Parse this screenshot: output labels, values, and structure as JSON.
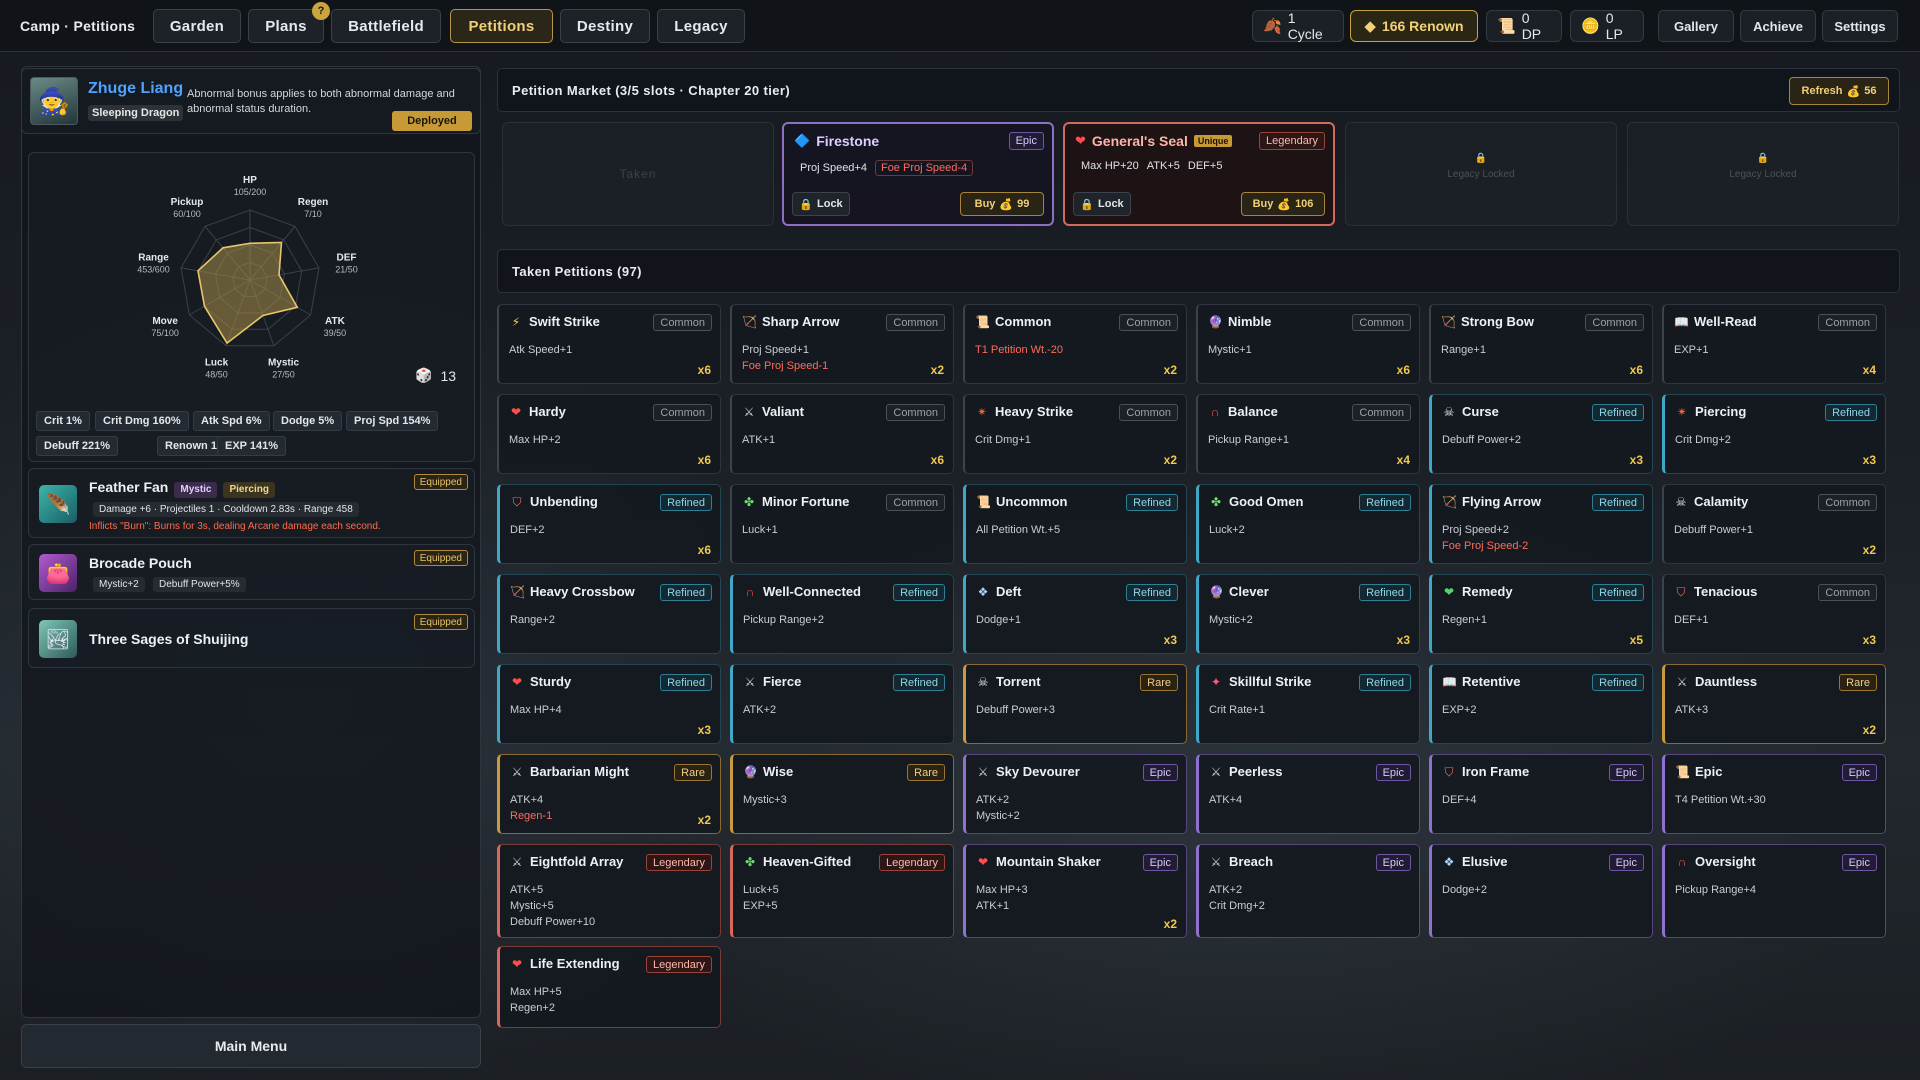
{
  "topbar": {
    "breadcrumb": "Camp · Petitions",
    "tabs": [
      "Garden",
      "Plans",
      "Battlefield",
      "Petitions",
      "Destiny",
      "Legacy"
    ],
    "active_tab": "Petitions",
    "plans_badge": "?",
    "resources": {
      "cycle": "1 Cycle",
      "renown": "166 Renown",
      "dp": "0 DP",
      "lp": "0 LP"
    },
    "buttons": [
      "Gallery",
      "Achieve",
      "Settings"
    ]
  },
  "hero": {
    "name": "Zhuge Liang",
    "title": "Sleeping Dragon",
    "description": "Abnormal bonus applies to both abnormal damage and abnormal status duration.",
    "status": "Deployed"
  },
  "radar": {
    "axes": [
      {
        "label": "HP",
        "value": "105/200"
      },
      {
        "label": "Regen",
        "value": "7/10"
      },
      {
        "label": "DEF",
        "value": "21/50"
      },
      {
        "label": "ATK",
        "value": "39/50"
      },
      {
        "label": "Mystic",
        "value": "27/50"
      },
      {
        "label": "Luck",
        "value": "48/50"
      },
      {
        "label": "Move",
        "value": "75/100"
      },
      {
        "label": "Range",
        "value": "453/600"
      },
      {
        "label": "Pickup",
        "value": "60/100"
      }
    ],
    "fractions": [
      0.525,
      0.7,
      0.42,
      0.78,
      0.54,
      0.96,
      0.75,
      0.755,
      0.6
    ],
    "dice_value": "13"
  },
  "stat_chips": [
    "Crit 1%",
    "Crit Dmg 160%",
    "Atk Spd 6%",
    "Dodge 5%",
    "Proj Spd 154%",
    "Debuff 221%",
    "Renown 120%",
    "EXP 141%"
  ],
  "items": [
    {
      "name": "Feather Fan",
      "tags": [
        "Mystic",
        "Piercing"
      ],
      "status": "Equipped",
      "stats": "Damage +6 · Projectiles 1 · Cooldown 2.83s · Range 458",
      "effect": "Inflicts \"Burn\": Burns for 3s, dealing Arcane damage each second."
    },
    {
      "name": "Brocade Pouch",
      "status": "Equipped",
      "stats": [
        "Mystic+2",
        "Debuff Power+5%"
      ]
    },
    {
      "name": "Three Sages of Shuijing",
      "status": "Equipped"
    }
  ],
  "main_menu": "Main Menu",
  "market": {
    "title": "Petition Market (3/5 slots · Chapter 20 tier)",
    "refresh_label": "Refresh",
    "refresh_cost": "56",
    "taken_label": "Taken",
    "locked_label": "Legacy Locked",
    "offers": [
      {
        "name": "Firestone",
        "rarity": "Epic",
        "stats": [
          "Proj Speed+4"
        ],
        "neg_stats": [
          "Foe Proj Speed-4"
        ],
        "lock_label": "Lock",
        "buy_label": "Buy",
        "cost": "99"
      },
      {
        "name": "General's Seal",
        "unique": "Unique",
        "rarity": "Legendary",
        "stats": [
          "Max HP+20",
          "ATK+5",
          "DEF+5"
        ],
        "lock_label": "Lock",
        "buy_label": "Buy",
        "cost": "106"
      }
    ]
  },
  "taken": {
    "title": "Taken Petitions (97)",
    "cards": [
      {
        "name": "Swift Strike",
        "rarity": "Common",
        "icon": "lightning-icon",
        "lines": [
          "Atk Speed+1"
        ],
        "neg": [],
        "count": "x6"
      },
      {
        "name": "Sharp Arrow",
        "rarity": "Common",
        "icon": "arrow-icon",
        "lines": [
          "Proj Speed+1"
        ],
        "neg": [
          "Foe Proj Speed-1"
        ],
        "count": "x2"
      },
      {
        "name": "Common",
        "rarity": "Common",
        "icon": "scroll-icon",
        "lines": [],
        "neg": [
          "T1 Petition Wt.-20"
        ],
        "count": "x2"
      },
      {
        "name": "Nimble",
        "rarity": "Common",
        "icon": "mystic-orb-icon",
        "lines": [
          "Mystic+1"
        ],
        "neg": [],
        "count": "x6"
      },
      {
        "name": "Strong Bow",
        "rarity": "Common",
        "icon": "bow-icon",
        "lines": [
          "Range+1"
        ],
        "neg": [],
        "count": "x6"
      },
      {
        "name": "Well-Read",
        "rarity": "Common",
        "icon": "book-icon",
        "lines": [
          "EXP+1"
        ],
        "neg": [],
        "count": "x4"
      },
      {
        "name": "Hardy",
        "rarity": "Common",
        "icon": "heart-icon",
        "lines": [
          "Max HP+2"
        ],
        "neg": [],
        "count": "x6"
      },
      {
        "name": "Valiant",
        "rarity": "Common",
        "icon": "swords-icon",
        "lines": [
          "ATK+1"
        ],
        "neg": [],
        "count": "x6"
      },
      {
        "name": "Heavy Strike",
        "rarity": "Common",
        "icon": "burst-icon",
        "lines": [
          "Crit Dmg+1"
        ],
        "neg": [],
        "count": "x2"
      },
      {
        "name": "Balance",
        "rarity": "Common",
        "icon": "magnet-icon",
        "lines": [
          "Pickup Range+1"
        ],
        "neg": [],
        "count": "x4"
      },
      {
        "name": "Curse",
        "rarity": "Refined",
        "icon": "skull-icon",
        "lines": [
          "Debuff Power+2"
        ],
        "neg": [],
        "count": "x3"
      },
      {
        "name": "Piercing",
        "rarity": "Refined",
        "icon": "burst-icon",
        "lines": [
          "Crit Dmg+2"
        ],
        "neg": [],
        "count": "x3"
      },
      {
        "name": "Unbending",
        "rarity": "Refined",
        "icon": "shield-icon",
        "lines": [
          "DEF+2"
        ],
        "neg": [],
        "count": "x6"
      },
      {
        "name": "Minor Fortune",
        "rarity": "Common",
        "icon": "clover-icon",
        "lines": [
          "Luck+1"
        ],
        "neg": [],
        "count": ""
      },
      {
        "name": "Uncommon",
        "rarity": "Refined",
        "icon": "scroll-icon",
        "lines": [
          "All Petition Wt.+5"
        ],
        "neg": [],
        "count": ""
      },
      {
        "name": "Good Omen",
        "rarity": "Refined",
        "icon": "clover-icon",
        "lines": [
          "Luck+2"
        ],
        "neg": [],
        "count": ""
      },
      {
        "name": "Flying Arrow",
        "rarity": "Refined",
        "icon": "arrow-icon",
        "lines": [
          "Proj Speed+2"
        ],
        "neg": [
          "Foe Proj Speed-2"
        ],
        "count": ""
      },
      {
        "name": "Calamity",
        "rarity": "Common",
        "icon": "skull-icon",
        "lines": [
          "Debuff Power+1"
        ],
        "neg": [],
        "count": "x2"
      },
      {
        "name": "Heavy Crossbow",
        "rarity": "Refined",
        "icon": "bow-icon",
        "lines": [
          "Range+2"
        ],
        "neg": [],
        "count": ""
      },
      {
        "name": "Well-Connected",
        "rarity": "Refined",
        "icon": "magnet-icon",
        "lines": [
          "Pickup Range+2"
        ],
        "neg": [],
        "count": ""
      },
      {
        "name": "Deft",
        "rarity": "Refined",
        "icon": "wing-icon",
        "lines": [
          "Dodge+1"
        ],
        "neg": [],
        "count": "x3"
      },
      {
        "name": "Clever",
        "rarity": "Refined",
        "icon": "mystic-orb-icon",
        "lines": [
          "Mystic+2"
        ],
        "neg": [],
        "count": "x3"
      },
      {
        "name": "Remedy",
        "rarity": "Refined",
        "icon": "green-heart-icon",
        "lines": [
          "Regen+1"
        ],
        "neg": [],
        "count": "x5"
      },
      {
        "name": "Tenacious",
        "rarity": "Common",
        "icon": "shield-icon",
        "lines": [
          "DEF+1"
        ],
        "neg": [],
        "count": "x3"
      },
      {
        "name": "Sturdy",
        "rarity": "Refined",
        "icon": "heart-icon",
        "lines": [
          "Max HP+4"
        ],
        "neg": [],
        "count": "x3"
      },
      {
        "name": "Fierce",
        "rarity": "Refined",
        "icon": "swords-icon",
        "lines": [
          "ATK+2"
        ],
        "neg": [],
        "count": ""
      },
      {
        "name": "Torrent",
        "rarity": "Rare",
        "icon": "skull-icon",
        "lines": [
          "Debuff Power+3"
        ],
        "neg": [],
        "count": ""
      },
      {
        "name": "Skillful Strike",
        "rarity": "Refined",
        "icon": "crit-icon",
        "lines": [
          "Crit Rate+1"
        ],
        "neg": [],
        "count": ""
      },
      {
        "name": "Retentive",
        "rarity": "Refined",
        "icon": "book-icon",
        "lines": [
          "EXP+2"
        ],
        "neg": [],
        "count": ""
      },
      {
        "name": "Dauntless",
        "rarity": "Rare",
        "icon": "swords-icon",
        "lines": [
          "ATK+3"
        ],
        "neg": [],
        "count": "x2"
      },
      {
        "name": "Barbarian Might",
        "rarity": "Rare",
        "icon": "swords-icon",
        "lines": [
          "ATK+4"
        ],
        "neg": [
          "Regen-1"
        ],
        "count": "x2"
      },
      {
        "name": "Wise",
        "rarity": "Rare",
        "icon": "mystic-orb-icon",
        "lines": [
          "Mystic+3"
        ],
        "neg": [],
        "count": ""
      },
      {
        "name": "Sky Devourer",
        "rarity": "Epic",
        "icon": "swords-icon",
        "lines": [
          "ATK+2",
          "Mystic+2"
        ],
        "neg": [],
        "count": ""
      },
      {
        "name": "Peerless",
        "rarity": "Epic",
        "icon": "swords-icon",
        "lines": [
          "ATK+4"
        ],
        "neg": [],
        "count": ""
      },
      {
        "name": "Iron Frame",
        "rarity": "Epic",
        "icon": "shield-icon",
        "lines": [
          "DEF+4"
        ],
        "neg": [],
        "count": ""
      },
      {
        "name": "Epic",
        "rarity": "Epic",
        "icon": "scroll-icon",
        "lines": [
          "T4 Petition Wt.+30"
        ],
        "neg": [],
        "count": ""
      },
      {
        "name": "Eightfold Array",
        "rarity": "Legendary",
        "icon": "swords-icon",
        "lines": [
          "ATK+5",
          "Mystic+5",
          "Debuff Power+10"
        ],
        "neg": [],
        "count": ""
      },
      {
        "name": "Heaven-Gifted",
        "rarity": "Legendary",
        "icon": "clover-icon",
        "lines": [
          "Luck+5",
          "EXP+5"
        ],
        "neg": [],
        "count": ""
      },
      {
        "name": "Mountain Shaker",
        "rarity": "Epic",
        "icon": "heart-icon",
        "lines": [
          "Max HP+3",
          "ATK+1"
        ],
        "neg": [],
        "count": "x2"
      },
      {
        "name": "Breach",
        "rarity": "Epic",
        "icon": "swords-icon",
        "lines": [
          "ATK+2",
          "Crit Dmg+2"
        ],
        "neg": [],
        "count": ""
      },
      {
        "name": "Elusive",
        "rarity": "Epic",
        "icon": "wing-icon",
        "lines": [
          "Dodge+2"
        ],
        "neg": [],
        "count": ""
      },
      {
        "name": "Oversight",
        "rarity": "Epic",
        "icon": "magnet-icon",
        "lines": [
          "Pickup Range+4"
        ],
        "neg": [],
        "count": ""
      },
      {
        "name": "Life Extending",
        "rarity": "Legendary",
        "icon": "heart-icon",
        "lines": [
          "Max HP+5",
          "Regen+2"
        ],
        "neg": [],
        "count": ""
      }
    ]
  }
}
